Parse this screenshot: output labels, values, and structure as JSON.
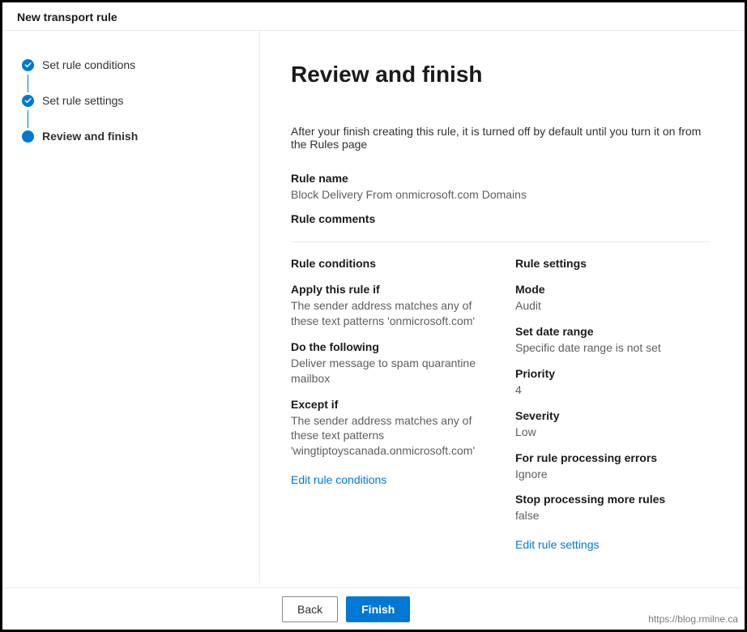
{
  "header": {
    "title": "New transport rule"
  },
  "steps": [
    {
      "label": "Set rule conditions",
      "state": "done"
    },
    {
      "label": "Set rule settings",
      "state": "done"
    },
    {
      "label": "Review and finish",
      "state": "active"
    }
  ],
  "page": {
    "title": "Review and finish",
    "intro": "After your finish creating this rule, it is turned off by default until you turn it on from the Rules page",
    "rule_name_label": "Rule name",
    "rule_name_value": "Block Delivery From onmicrosoft.com Domains",
    "rule_comments_label": "Rule comments"
  },
  "conditions": {
    "heading": "Rule conditions",
    "apply_label": "Apply this rule if",
    "apply_value": "The sender address matches any of these text patterns 'onmicrosoft.com'",
    "do_label": "Do the following",
    "do_value": "Deliver message to spam quarantine mailbox",
    "except_label": "Except if",
    "except_value": "The sender address matches any of these text patterns 'wingtiptoyscanada.onmicrosoft.com'",
    "edit_link": "Edit rule conditions"
  },
  "settings": {
    "heading": "Rule settings",
    "mode_label": "Mode",
    "mode_value": "Audit",
    "date_label": "Set date range",
    "date_value": "Specific date range is not set",
    "priority_label": "Priority",
    "priority_value": "4",
    "severity_label": "Severity",
    "severity_value": "Low",
    "errors_label": "For rule processing errors",
    "errors_value": "Ignore",
    "stop_label": "Stop processing more rules",
    "stop_value": "false",
    "edit_link": "Edit rule settings"
  },
  "footer": {
    "back_label": "Back",
    "finish_label": "Finish"
  },
  "watermark": "https://blog.rmilne.ca"
}
